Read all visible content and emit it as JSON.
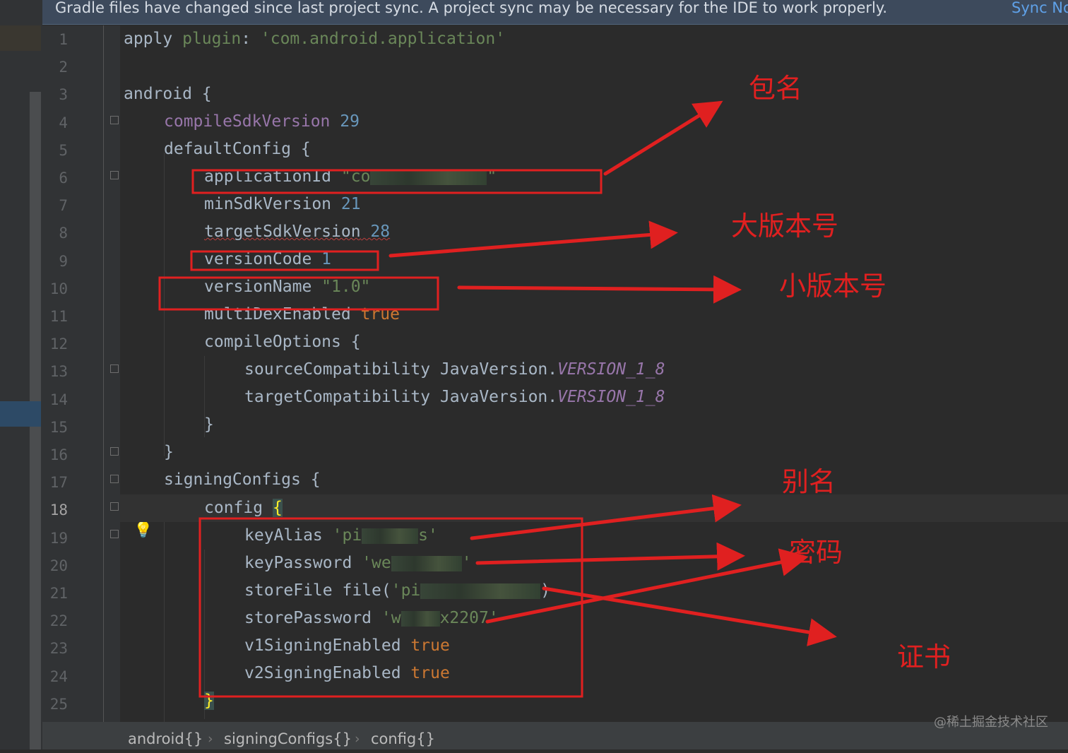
{
  "banner": {
    "message": "Gradle files have changed since last project sync. A project sync may be necessary for the IDE to work properly.",
    "action": "Sync No"
  },
  "gutter": {
    "line_numbers": [
      "1",
      "2",
      "3",
      "4",
      "5",
      "6",
      "7",
      "8",
      "9",
      "10",
      "11",
      "12",
      "13",
      "14",
      "15",
      "16",
      "17",
      "18",
      "19",
      "20",
      "21",
      "22",
      "23",
      "24",
      "25"
    ],
    "current_line": "18"
  },
  "code": {
    "l1": {
      "a": "apply ",
      "b": "plugin",
      "c": ": ",
      "d": "'com.android.application'"
    },
    "l3": {
      "a": "android {"
    },
    "l4": {
      "a": "compileSdkVersion",
      "b": " 29"
    },
    "l5": {
      "a": "defaultConfig {"
    },
    "l6": {
      "a": "applicationId ",
      "b": "\"co",
      "c": "\""
    },
    "l7": {
      "a": "minSdkVersion ",
      "b": "21"
    },
    "l8": {
      "a": "targetSdkVersion",
      "b": " 28"
    },
    "l9": {
      "a": "versionCode ",
      "b": "1"
    },
    "l10": {
      "a": "versionName ",
      "b": "\"1.0\""
    },
    "l11": {
      "a": "multiDexEnabled ",
      "b": "true"
    },
    "l12": {
      "a": "compileOptions {"
    },
    "l13": {
      "a": "sourceCompatibility JavaVersion.",
      "b": "VERSION_1_8"
    },
    "l14": {
      "a": "targetCompatibility JavaVersion.",
      "b": "VERSION_1_8"
    },
    "l15": {
      "a": "}"
    },
    "l16": {
      "a": "}"
    },
    "l17": {
      "a": "signingConfigs {"
    },
    "l18": {
      "a": "config ",
      "b": "{"
    },
    "l19": {
      "a": "keyAlias ",
      "b": "'pi",
      "c": "s'"
    },
    "l20": {
      "a": "keyPassword ",
      "b": "'we",
      "c": "'"
    },
    "l21": {
      "a": "storeFile file(",
      "b": "'pi",
      "c": ")"
    },
    "l22": {
      "a": "storePassword ",
      "b": "'w",
      "c": "x2207'"
    },
    "l23": {
      "a": "v1SigningEnabled ",
      "b": "true"
    },
    "l24": {
      "a": "v2SigningEnabled ",
      "b": "true"
    },
    "l25": {
      "a": "}"
    }
  },
  "annotations": {
    "package_name": "包名",
    "major_version": "大版本号",
    "minor_version": "小版本号",
    "alias": "别名",
    "password": "密码",
    "certificate": "证书",
    "color": "#e02020"
  },
  "breadcrumbs": [
    "android{}",
    "signingConfigs{}",
    "config{}"
  ],
  "watermark": "@稀土掘金技术社区"
}
